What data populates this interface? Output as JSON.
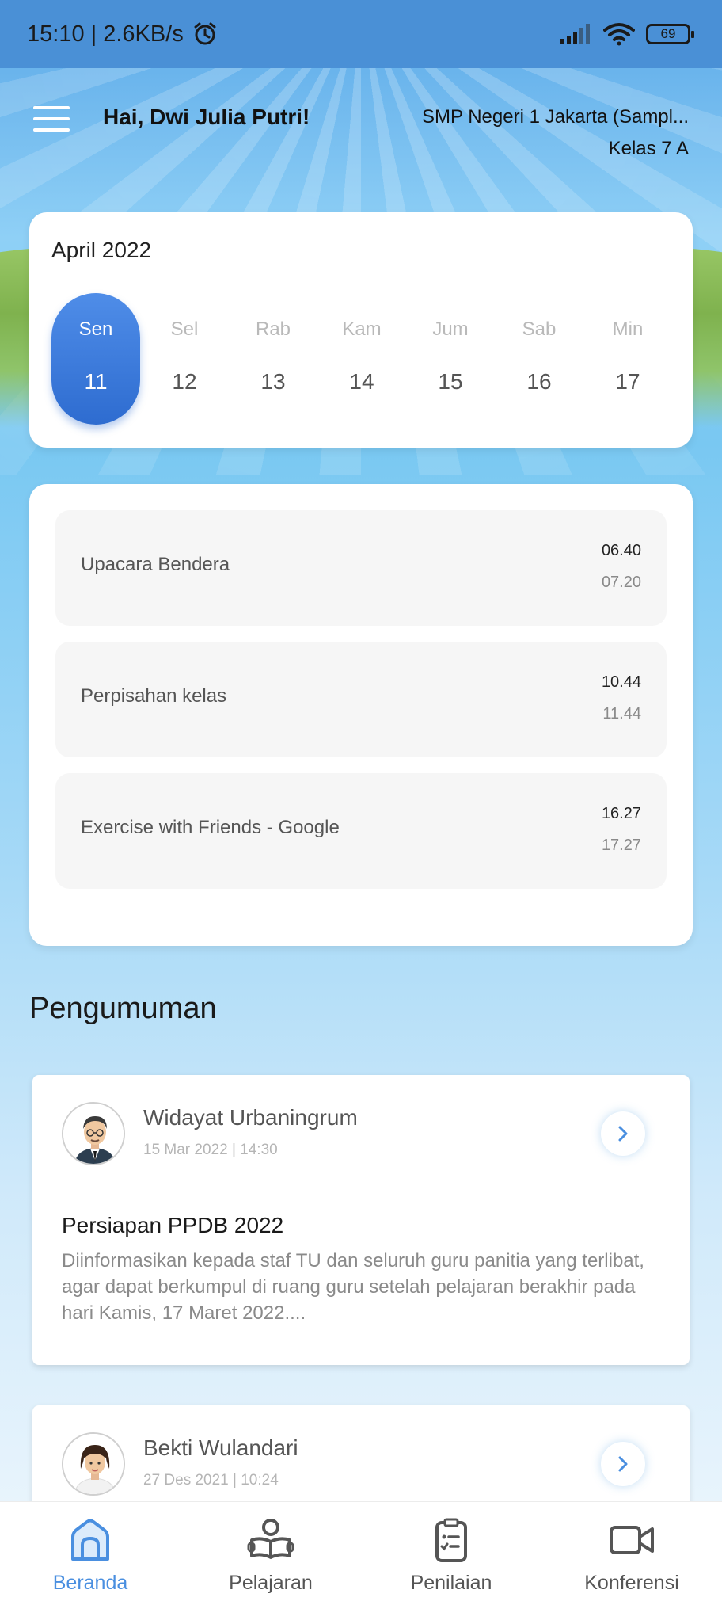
{
  "status_bar": {
    "time_speed": "15:10 | 2.6KB/s",
    "battery": "69",
    "icons": [
      "alarm-icon",
      "signal-icon",
      "wifi-icon",
      "battery-icon"
    ]
  },
  "header": {
    "greeting": "Hai, Dwi Julia Putri!",
    "school": "SMP Negeri 1 Jakarta (Sampl...",
    "class": "Kelas 7 A"
  },
  "calendar": {
    "month": "April 2022",
    "days": [
      {
        "name": "Sen",
        "num": "11",
        "active": true
      },
      {
        "name": "Sel",
        "num": "12",
        "active": false
      },
      {
        "name": "Rab",
        "num": "13",
        "active": false
      },
      {
        "name": "Kam",
        "num": "14",
        "active": false
      },
      {
        "name": "Jum",
        "num": "15",
        "active": false
      },
      {
        "name": "Sab",
        "num": "16",
        "active": false
      },
      {
        "name": "Min",
        "num": "17",
        "active": false
      }
    ]
  },
  "schedule": [
    {
      "title": "Upacara Bendera",
      "start": "06.40",
      "end": "07.20"
    },
    {
      "title": "Perpisahan kelas",
      "start": "10.44",
      "end": "11.44"
    },
    {
      "title": "Exercise with Friends - Google",
      "start": "16.27",
      "end": "17.27"
    }
  ],
  "announcements": {
    "section_title": "Pengumuman",
    "items": [
      {
        "author": "Widayat Urbaningrum",
        "date": "15 Mar 2022 | 14:30",
        "title": "Persiapan PPDB 2022",
        "body": "Diinformasikan kepada staf TU dan seluruh guru panitia yang terlibat, agar dapat berkumpul di ruang guru setelah pelajaran berakhir pada hari Kamis, 17 Maret 2022...."
      },
      {
        "author": "Bekti Wulandari",
        "date": "27 Des 2021 | 10:24"
      }
    ]
  },
  "bottom_nav": [
    {
      "label": "Beranda",
      "icon": "home-icon",
      "active": true
    },
    {
      "label": "Pelajaran",
      "icon": "book-reader-icon",
      "active": false
    },
    {
      "label": "Penilaian",
      "icon": "clipboard-icon",
      "active": false
    },
    {
      "label": "Konferensi",
      "icon": "video-icon",
      "active": false
    }
  ],
  "colors": {
    "accent": "#4a8fe0",
    "active_day": "#2e6cd0",
    "status_bar": "#4a90d6"
  }
}
